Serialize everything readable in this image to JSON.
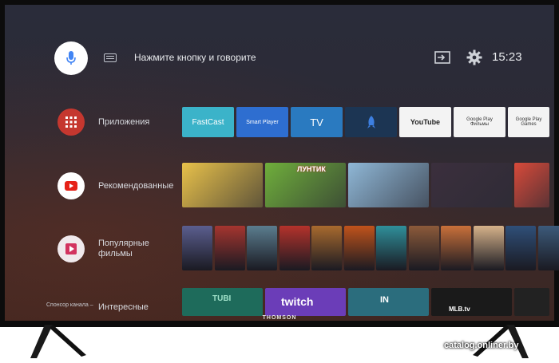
{
  "search": {
    "prompt": "Нажмите кнопку и говорите"
  },
  "header": {
    "clock": "15:23"
  },
  "rows": {
    "apps": {
      "label": "Приложения"
    },
    "recommended": {
      "label": "Рекомендованные"
    },
    "popular": {
      "label_line1": "Популярные",
      "label_line2": "фильмы"
    },
    "interesting": {
      "label": "Интересные"
    }
  },
  "apps": [
    {
      "label": "FastCast",
      "color": "#3bb3c9"
    },
    {
      "label": "Smart Player",
      "color": "#2e6ed0"
    },
    {
      "label": "TV",
      "color": "#2a7ac0"
    },
    {
      "label": "",
      "color": "#1c3553"
    },
    {
      "label": "YouTube",
      "color": "#f3f3f3"
    },
    {
      "label": "Google Play Фильмы",
      "color": "#f3f3f3"
    },
    {
      "label": "Google Play Games",
      "color": "#f3f3f3"
    }
  ],
  "recommended": [
    {
      "title": "",
      "color": "#e8c14a"
    },
    {
      "title": "ЛУНТИК",
      "color": "#6fae3b"
    },
    {
      "title": "",
      "color": "#8fb7d6"
    },
    {
      "title": "",
      "color": "#3b2f3d"
    },
    {
      "title": "",
      "color": "#d84a3a"
    }
  ],
  "popular": [
    {
      "title": "",
      "color": "#5b5e8f"
    },
    {
      "title": "",
      "color": "#a5352f"
    },
    {
      "title": "",
      "color": "#5b7d8f"
    },
    {
      "title": "",
      "color": "#b4322b"
    },
    {
      "title": "",
      "color": "#a86a2e"
    },
    {
      "title": "",
      "color": "#c0531b"
    },
    {
      "title": "",
      "color": "#2f8f9a"
    },
    {
      "title": "",
      "color": "#8c5a3a"
    },
    {
      "title": "",
      "color": "#c9703a"
    },
    {
      "title": "",
      "color": "#d6b28a"
    },
    {
      "title": "",
      "color": "#2f4f78"
    },
    {
      "title": "",
      "color": "#3c5a7a"
    }
  ],
  "bottom": [
    {
      "label": "TUBI",
      "color": "#1e6b5b"
    },
    {
      "label": "twitch",
      "color": "#6b3db8"
    },
    {
      "label": "IN",
      "color": "#2b6d7d"
    },
    {
      "label": "MLB.tv",
      "color": "#1a1a1a"
    },
    {
      "label": "",
      "color": "#222222"
    }
  ],
  "footer": {
    "sponsor": "Спонсор канала –",
    "brand": "THOMSON",
    "watermark": "catalog.onliner.by"
  }
}
